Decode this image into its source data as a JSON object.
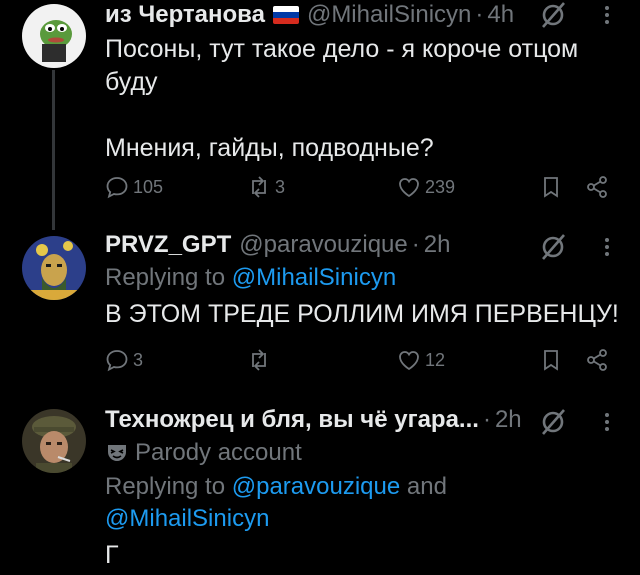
{
  "tweets": [
    {
      "name": "из Чертанова",
      "handle": "@MihailSinicyn",
      "time": "4h",
      "text": "Посоны, тут такое дело - я короче отцом буду\n\nМнения, гайды, подводные?",
      "replies": "105",
      "retweets": "3",
      "likes": "239"
    },
    {
      "name": "PRVZ_GPT",
      "handle": "@paravouzique",
      "time": "2h",
      "replying_prefix": "Replying to",
      "replying_to": "@MihailSinicyn",
      "text": "В ЭТОМ ТРЕДЕ РОЛЛИМ ИМЯ ПЕРВЕНЦУ!",
      "replies": "3",
      "retweets": "",
      "likes": "12"
    },
    {
      "name": "Техножрец и бля, вы чё угара...",
      "time": "2h",
      "parody_label": "Parody account",
      "replying_prefix": "Replying to",
      "replying_to_1": "@paravouzique",
      "replying_and": "and",
      "replying_to_2": "@MihailSinicyn",
      "text": "Г"
    }
  ],
  "icons": {
    "reply": "reply-icon",
    "retweet": "retweet-icon",
    "like": "heart-icon",
    "bookmark": "bookmark-icon",
    "share": "share-icon",
    "grok": "grok-icon",
    "more": "more-icon",
    "parody": "parody-mask-icon",
    "flag": "russia-flag-icon"
  },
  "colors": {
    "background": "#000000",
    "text": "#e7e9ea",
    "muted": "#71767b",
    "link": "#1d9bf0"
  }
}
